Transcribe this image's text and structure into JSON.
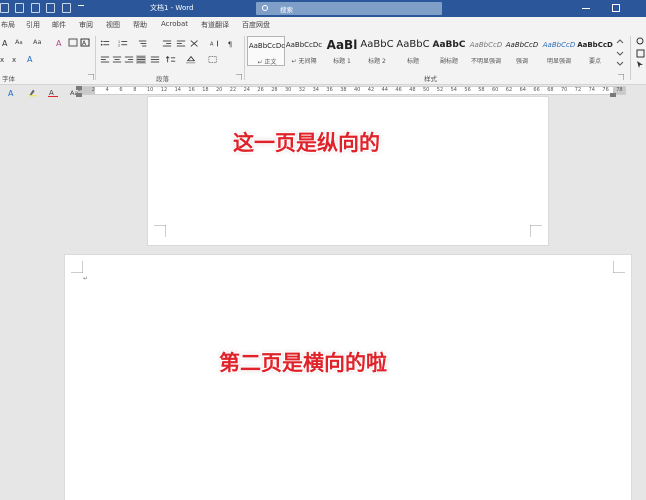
{
  "title_bar": {
    "doc_title": "文档1 - Word",
    "search_placeholder": "搜索",
    "colors": {
      "title_bg": "#2b579a"
    }
  },
  "menu": {
    "tabs": [
      "布局",
      "引用",
      "邮件",
      "审阅",
      "视图",
      "帮助",
      "Acrobat",
      "有道翻译",
      "百度网盘"
    ]
  },
  "ribbon": {
    "font_size_value": "Aa",
    "groups": {
      "font_label": "字体",
      "paragraph_label": "段落",
      "styles_label": "样式"
    },
    "styles": [
      {
        "sample": "AaBbCcDc",
        "name": "↵ 正文"
      },
      {
        "sample": "AaBbCcDc",
        "name": "↵ 无间隔"
      },
      {
        "sample": "AaBl",
        "name": "标题 1"
      },
      {
        "sample": "AaBbC",
        "name": "标题 2"
      },
      {
        "sample": "AaBbC",
        "name": "标题"
      },
      {
        "sample": "AaBbC",
        "name": "副标题"
      },
      {
        "sample": "AaBbCcD",
        "name": "不明显强调"
      },
      {
        "sample": "AaBbCcD",
        "name": "强调"
      },
      {
        "sample": "AaBbCcD",
        "name": "明显强调"
      },
      {
        "sample": "AaBbCcD",
        "name": "要点"
      }
    ]
  },
  "ruler": {
    "numbers": [
      "2",
      "2",
      "4",
      "6",
      "8",
      "10",
      "12",
      "14",
      "16",
      "18",
      "20",
      "22",
      "24",
      "26",
      "28",
      "30",
      "32",
      "34",
      "36",
      "38",
      "40",
      "42",
      "44",
      "46",
      "48",
      "50",
      "52",
      "54",
      "56",
      "58",
      "60",
      "62",
      "64",
      "66",
      "68",
      "70",
      "72",
      "74",
      "76",
      "78"
    ]
  },
  "document": {
    "page1_text": "这一页是纵向的",
    "page2_text": "第二页是横向的啦",
    "text_color": "#e0232a"
  }
}
